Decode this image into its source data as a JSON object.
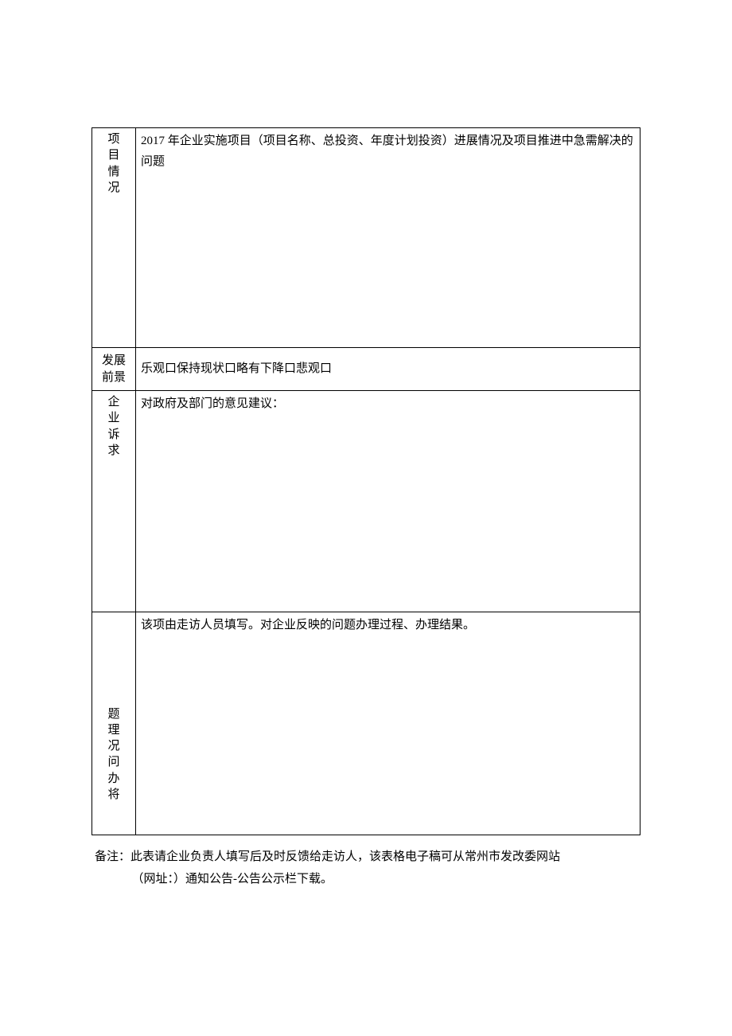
{
  "rows": {
    "project": {
      "label": "项目情况",
      "content": "2017 年企业实施项目（项目名称、总投资、年度计划投资）进展情况及项目推进中急需解决的问题"
    },
    "outlook": {
      "label": "发展前景",
      "content": "乐观口保持现状口略有下降口悲观口"
    },
    "appeal": {
      "label": "企业诉求",
      "content": "对政府及部门的意见建议："
    },
    "handling": {
      "label": "题理况问办将",
      "content": "该项由走访人员填写。对企业反映的问题办理过程、办理结果。"
    }
  },
  "footnote": {
    "line1": "备注：此表请企业负责人填写后及时反馈给走访人，该表格电子稿可从常州市发改委网站",
    "line2": "（网址：）通知公告-公告公示栏下载。"
  }
}
